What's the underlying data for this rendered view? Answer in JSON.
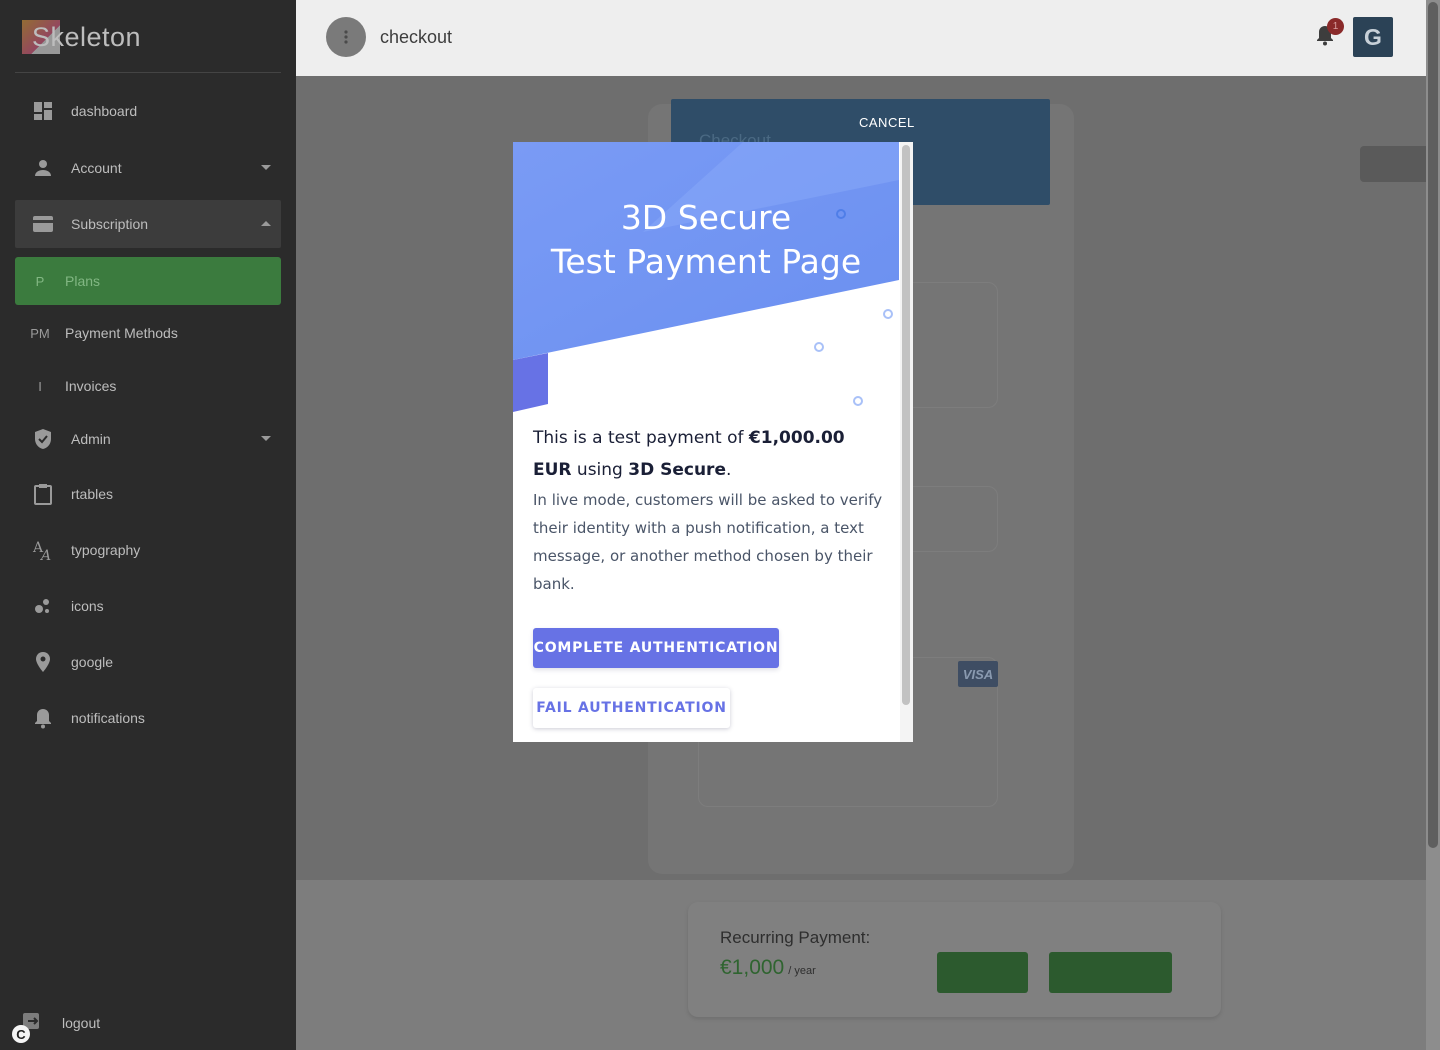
{
  "sidebar": {
    "brand": "Skeleton",
    "items": [
      {
        "label": "dashboard",
        "icon": "dashboard-icon"
      },
      {
        "label": "Account",
        "icon": "person-icon"
      },
      {
        "label": "Subscription",
        "icon": "credit-card-icon"
      },
      {
        "abbr": "P",
        "label": "Plans"
      },
      {
        "abbr": "PM",
        "label": "Payment Methods"
      },
      {
        "abbr": "I",
        "label": "Invoices"
      },
      {
        "label": "Admin",
        "icon": "shield-icon"
      },
      {
        "label": "rtables",
        "icon": "clipboard-icon"
      },
      {
        "label": "typography",
        "icon": "typography-icon"
      },
      {
        "label": "icons",
        "icon": "bubbles-icon"
      },
      {
        "label": "google",
        "icon": "location-pin-icon"
      },
      {
        "label": "notifications",
        "icon": "bell-icon"
      }
    ],
    "logout": "logout"
  },
  "topbar": {
    "title": "checkout",
    "notification_count": "1",
    "avatar_initial": "G"
  },
  "checkout_card": {
    "header_title": "Checkout",
    "card_brand": "VISA"
  },
  "recurring": {
    "label": "Recurring Payment:",
    "amount": "€1,000",
    "period": "/ year"
  },
  "modal": {
    "cancel": "CANCEL",
    "title_line1": "3D Secure",
    "title_line2": "Test Payment Page",
    "lead_prefix": "This is a test payment of ",
    "lead_amount": "€1,000.00 EUR",
    "lead_middle": " using ",
    "lead_method": "3D Secure",
    "lead_suffix": ".",
    "description": "In live mode, customers will be asked to verify their identity with a push notification, a text message, or another method chosen by their bank.",
    "complete_button": "COMPLETE AUTHENTICATION",
    "fail_button": "FAIL AUTHENTICATION"
  },
  "colors": {
    "accent": "#6772e5",
    "hero_blue": "#6f98f5",
    "active_green": "#3b7b3e"
  }
}
